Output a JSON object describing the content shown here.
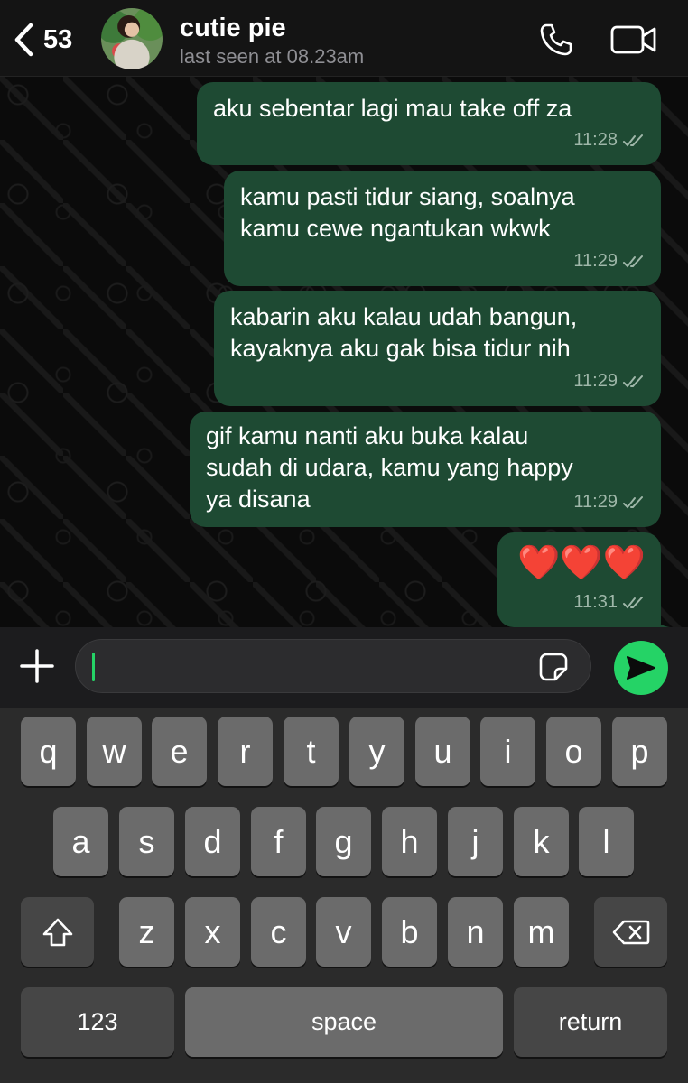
{
  "header": {
    "back_count": "53",
    "contact_name": "cutie pie",
    "last_seen": "last seen at 08.23am"
  },
  "messages": [
    {
      "lines": [
        "aku sebentar lagi mau take off za"
      ],
      "time": "11:28"
    },
    {
      "lines": [
        "kamu pasti tidur siang, soalnya",
        "kamu cewe ngantukan wkwk"
      ],
      "time": "11:29"
    },
    {
      "lines": [
        "kabarin aku kalau udah bangun,",
        "kayaknya aku gak bisa tidur nih"
      ],
      "time": "11:29"
    },
    {
      "lines": [
        "gif kamu nanti aku buka kalau",
        "sudah di udara, kamu yang happy",
        "ya disana"
      ],
      "time": "11:29"
    },
    {
      "lines": [
        "❤️❤️❤️"
      ],
      "time": "11:31"
    }
  ],
  "composer": {
    "value": ""
  },
  "keyboard": {
    "row1": [
      "q",
      "w",
      "e",
      "r",
      "t",
      "y",
      "u",
      "i",
      "o",
      "p"
    ],
    "row2": [
      "a",
      "s",
      "d",
      "f",
      "g",
      "h",
      "j",
      "k",
      "l"
    ],
    "row3": [
      "z",
      "x",
      "c",
      "v",
      "b",
      "n",
      "m"
    ],
    "numbers_label": "123",
    "space_label": "space",
    "return_label": "return"
  },
  "colors": {
    "bubble": "#1e4a33",
    "accent": "#25d366",
    "key": "#6b6b6b",
    "key_dark": "#464646"
  }
}
